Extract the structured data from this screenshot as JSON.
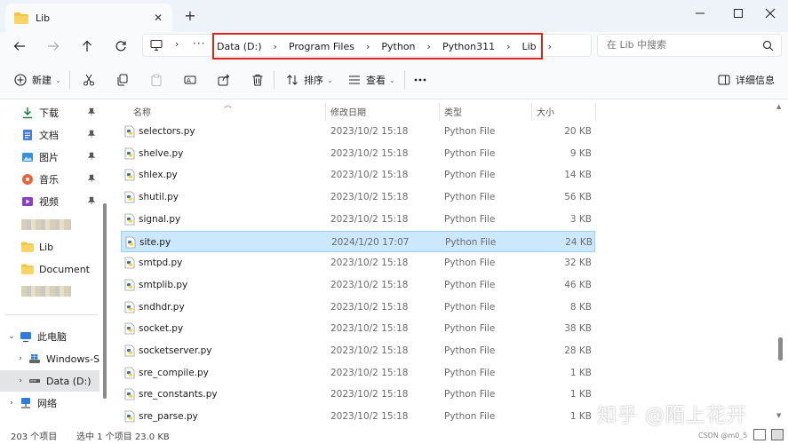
{
  "tab": {
    "title": "Lib"
  },
  "address": {
    "breadcrumbs": [
      "Data (D:)",
      "Program Files",
      "Python",
      "Python311",
      "Lib"
    ],
    "search_placeholder": "在 Lib 中搜索"
  },
  "toolbar": {
    "new_label": "新建",
    "sort_label": "排序",
    "view_label": "查看",
    "details_label": "详细信息"
  },
  "sidebar": {
    "quick_access": [
      {
        "label": "下载",
        "icon": "download-icon"
      },
      {
        "label": "文档",
        "icon": "document-icon"
      },
      {
        "label": "图片",
        "icon": "picture-icon"
      },
      {
        "label": "音乐",
        "icon": "music-icon"
      },
      {
        "label": "视频",
        "icon": "video-icon"
      }
    ],
    "folders": [
      "Lib",
      "Document"
    ],
    "this_pc": "此电脑",
    "drives": [
      "Windows-SSD",
      "Data (D:)"
    ],
    "network": "网络"
  },
  "columns": {
    "name": "名称",
    "date": "修改日期",
    "type": "类型",
    "size": "大小"
  },
  "files": [
    {
      "name": "selectors.py",
      "date": "2023/10/2 15:18",
      "type": "Python File",
      "size": "20 KB"
    },
    {
      "name": "shelve.py",
      "date": "2023/10/2 15:18",
      "type": "Python File",
      "size": "9 KB"
    },
    {
      "name": "shlex.py",
      "date": "2023/10/2 15:18",
      "type": "Python File",
      "size": "14 KB"
    },
    {
      "name": "shutil.py",
      "date": "2023/10/2 15:18",
      "type": "Python File",
      "size": "56 KB"
    },
    {
      "name": "signal.py",
      "date": "2023/10/2 15:18",
      "type": "Python File",
      "size": "3 KB"
    },
    {
      "name": "site.py",
      "date": "2024/1/20 17:07",
      "type": "Python File",
      "size": "24 KB",
      "selected": true
    },
    {
      "name": "smtpd.py",
      "date": "2023/10/2 15:18",
      "type": "Python File",
      "size": "32 KB"
    },
    {
      "name": "smtplib.py",
      "date": "2023/10/2 15:18",
      "type": "Python File",
      "size": "46 KB"
    },
    {
      "name": "sndhdr.py",
      "date": "2023/10/2 15:18",
      "type": "Python File",
      "size": "8 KB"
    },
    {
      "name": "socket.py",
      "date": "2023/10/2 15:18",
      "type": "Python File",
      "size": "38 KB"
    },
    {
      "name": "socketserver.py",
      "date": "2023/10/2 15:18",
      "type": "Python File",
      "size": "28 KB"
    },
    {
      "name": "sre_compile.py",
      "date": "2023/10/2 15:18",
      "type": "Python File",
      "size": "1 KB"
    },
    {
      "name": "sre_constants.py",
      "date": "2023/10/2 15:18",
      "type": "Python File",
      "size": "1 KB"
    },
    {
      "name": "sre_parse.py",
      "date": "2023/10/2 15:18",
      "type": "Python File",
      "size": "1 KB"
    }
  ],
  "status": {
    "item_count": "203 个项目",
    "selection": "选中 1 个项目  23.0 KB"
  },
  "watermarks": {
    "zhihu": "知乎 @陌上花开",
    "csdn": "CSDN @m0_5"
  },
  "colors": {
    "selection_bg": "#cce8ff",
    "highlight_border": "#d9221c",
    "folder": "#f4c542"
  }
}
